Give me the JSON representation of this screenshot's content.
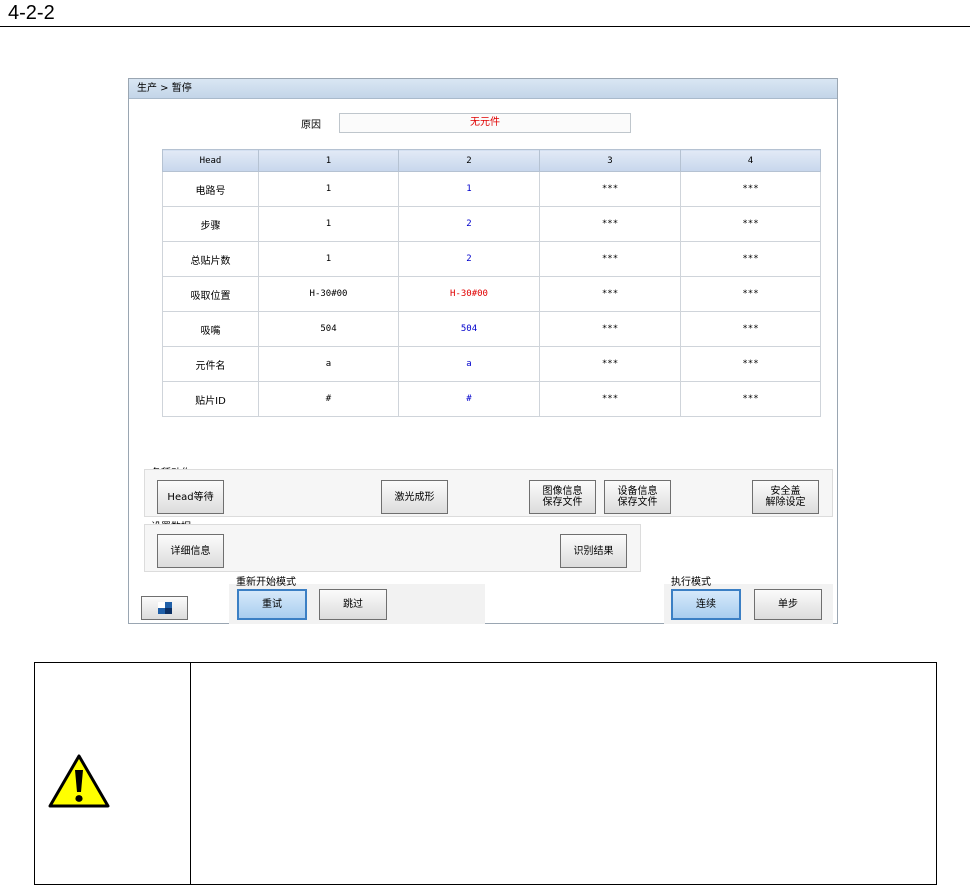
{
  "doc": {
    "section": "4-2-2"
  },
  "window": {
    "breadcrumb": "生产 > 暂停",
    "reason": {
      "label": "原因",
      "value": "无元件"
    },
    "table": {
      "headers": [
        "Head",
        "1",
        "2",
        "3",
        "4"
      ],
      "rows": [
        {
          "label": "电路号",
          "cells": [
            "1",
            "1",
            "***",
            "***"
          ]
        },
        {
          "label": "步骤",
          "cells": [
            "1",
            "2",
            "***",
            "***"
          ]
        },
        {
          "label": "总贴片数",
          "cells": [
            "1",
            "2",
            "***",
            "***"
          ]
        },
        {
          "label": "吸取位置",
          "cells": [
            "H-30#00",
            "H-30#00",
            "***",
            "***"
          ]
        },
        {
          "label": "吸嘴",
          "cells": [
            "504",
            "504",
            "***",
            "***"
          ]
        },
        {
          "label": "元件名",
          "cells": [
            "a",
            "a",
            "***",
            "***"
          ]
        },
        {
          "label": "贴片ID",
          "cells": [
            "#",
            "#",
            "***",
            "***"
          ]
        }
      ]
    },
    "actions": {
      "label": "各種动作",
      "head_wait": "Head等待",
      "laser": "激光成形",
      "image_info": "图像信息\n保存文件",
      "device_info": "设备信息\n保存文件",
      "safety": "安全盖\n解除设定"
    },
    "settings": {
      "label": "设置数据",
      "details": "详细信息",
      "recognition": "识别结果"
    },
    "restart": {
      "label": "重新开始模式",
      "retry": "重试",
      "skip": "跳过"
    },
    "exec": {
      "label": "执行模式",
      "continuous": "连续",
      "step": "单步"
    }
  },
  "colors": {
    "accent": "#3b7fc4",
    "error": "#e00000",
    "value_blue": "#0000cc",
    "warning": "#ffff00"
  },
  "icons": {
    "warning": "warning-triangle-icon",
    "restore": "restore-window-icon"
  }
}
